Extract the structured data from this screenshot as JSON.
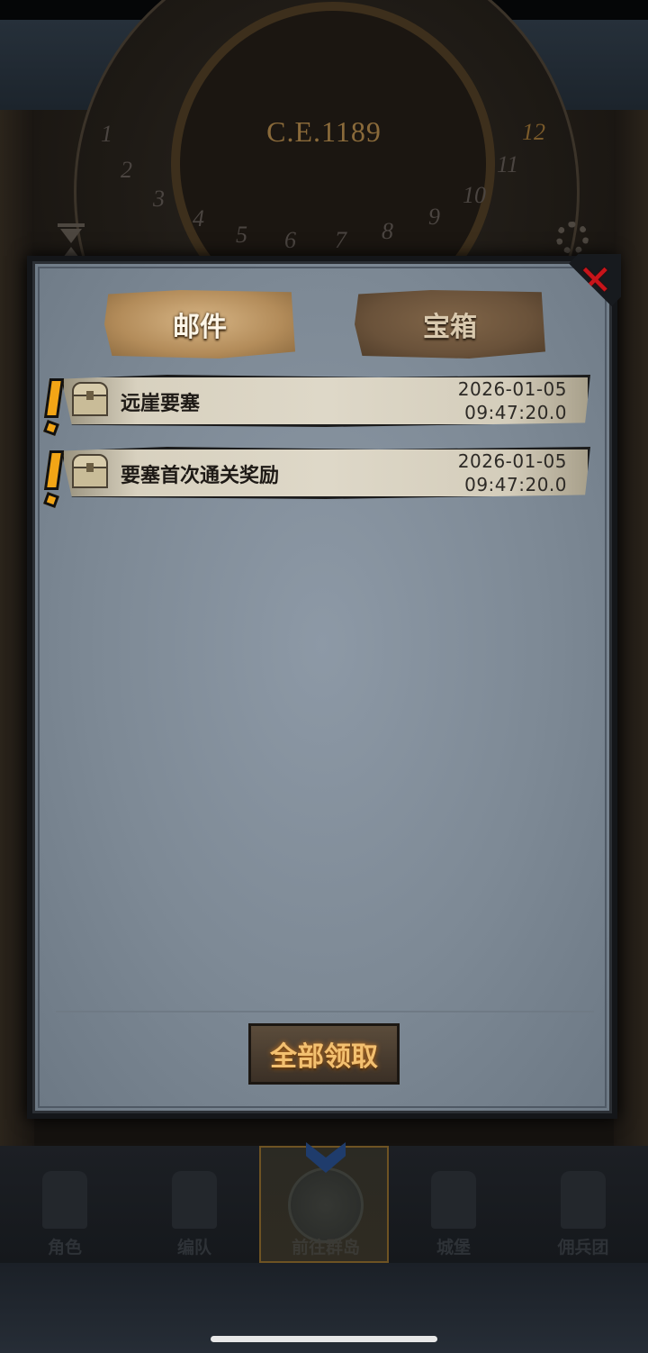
{
  "header": {
    "era": "C.E.1189",
    "dial_numbers": [
      "1",
      "2",
      "3",
      "4",
      "5",
      "6",
      "7",
      "8",
      "9",
      "10",
      "11",
      "12"
    ]
  },
  "dialog": {
    "tabs": [
      {
        "label": "邮件",
        "active": true
      },
      {
        "label": "宝箱",
        "active": false
      }
    ],
    "mails": [
      {
        "title": "远崖要塞",
        "date": "2026-01-05",
        "time": "09:47:20.0",
        "icon": "chest-icon",
        "alert": true
      },
      {
        "title": "要塞首次通关奖励",
        "date": "2026-01-05",
        "time": "09:47:20.0",
        "icon": "chest-icon",
        "alert": true
      }
    ],
    "claim_all_label": "全部领取",
    "close_icon": "close-icon"
  },
  "nav": {
    "items": [
      {
        "label": "角色",
        "icon": "knight-icon"
      },
      {
        "label": "编队",
        "icon": "helmet-icon"
      },
      {
        "label": "前往群岛",
        "icon": "compass-icon",
        "active": true
      },
      {
        "label": "城堡",
        "icon": "castle-icon"
      },
      {
        "label": "佣兵团",
        "icon": "banner-icon"
      }
    ]
  },
  "colors": {
    "accent_gold": "#f3c070",
    "alert": "#f2a516",
    "close": "#c8141a",
    "active_tab": "#b38c5a"
  }
}
